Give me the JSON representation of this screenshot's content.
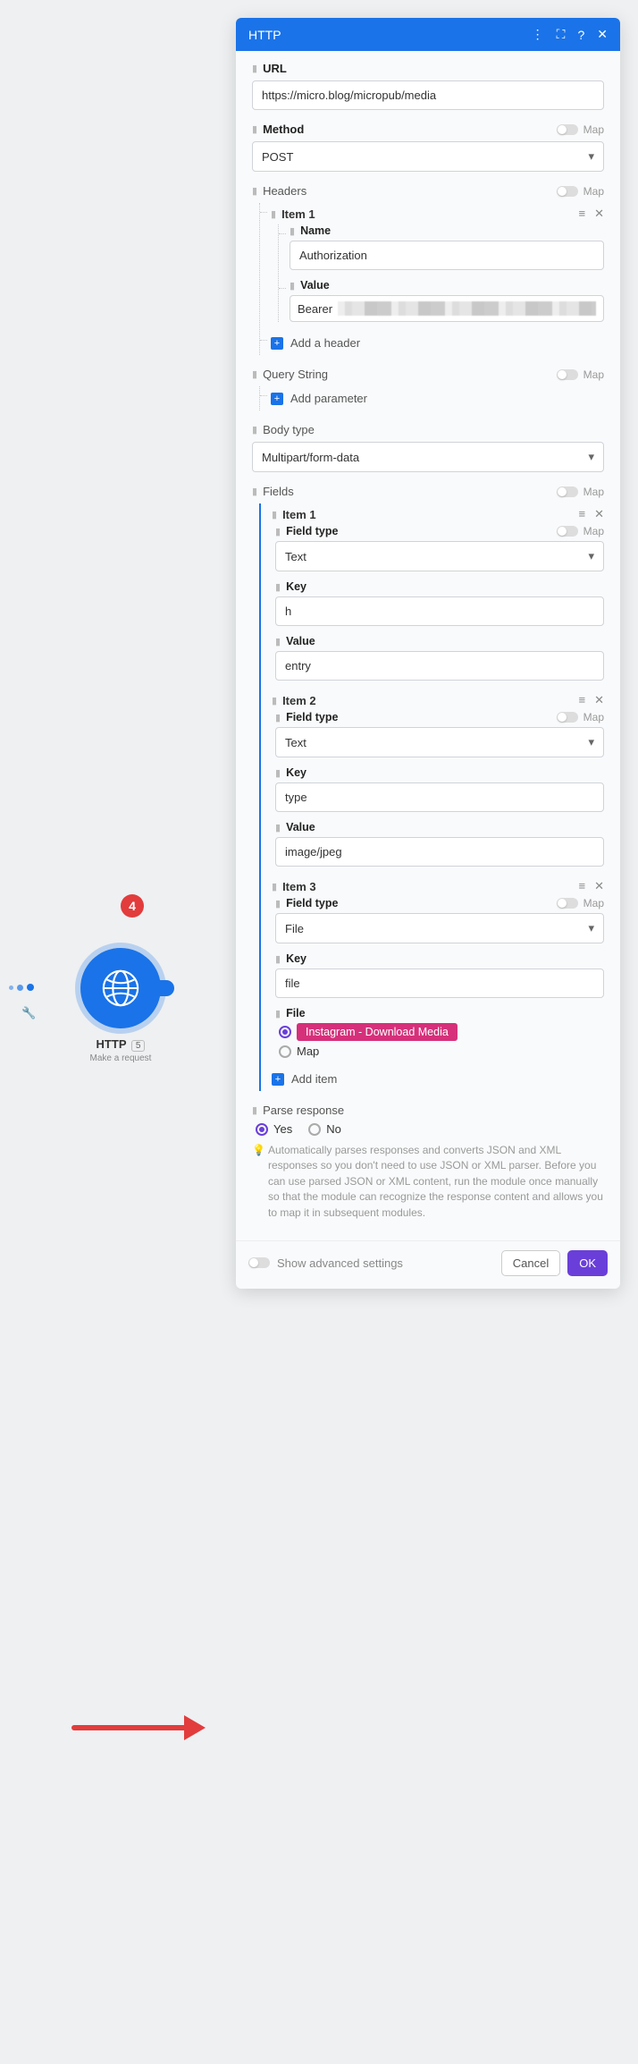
{
  "node": {
    "badge": "4",
    "title": "HTTP",
    "subtitle": "Make a request",
    "module_num": "5"
  },
  "panel": {
    "title": "HTTP",
    "url_label": "URL",
    "url_value": "https://micro.blog/micropub/media",
    "method_label": "Method",
    "method_value": "POST",
    "map_label": "Map",
    "headers_label": "Headers",
    "headers_item1_label": "Item 1",
    "headers_item1_name_label": "Name",
    "headers_item1_name_value": "Authorization",
    "headers_item1_value_label": "Value",
    "headers_item1_value_prefix": "Bearer",
    "add_header_label": "Add a header",
    "query_label": "Query String",
    "add_parameter_label": "Add parameter",
    "body_type_label": "Body type",
    "body_type_value": "Multipart/form-data",
    "fields_label": "Fields",
    "fields": {
      "item1": {
        "title": "Item 1",
        "fieldtype_label": "Field type",
        "fieldtype_value": "Text",
        "key_label": "Key",
        "key_value": "h",
        "value_label": "Value",
        "value_value": "entry"
      },
      "item2": {
        "title": "Item 2",
        "fieldtype_label": "Field type",
        "fieldtype_value": "Text",
        "key_label": "Key",
        "key_value": "type",
        "value_label": "Value",
        "value_value": "image/jpeg"
      },
      "item3": {
        "title": "Item 3",
        "fieldtype_label": "Field type",
        "fieldtype_value": "File",
        "key_label": "Key",
        "key_value": "file",
        "file_label": "File",
        "file_pill": "Instagram - Download Media",
        "file_map_option": "Map"
      }
    },
    "add_item_label": "Add item",
    "parse_response_label": "Parse response",
    "parse_yes": "Yes",
    "parse_no": "No",
    "parse_help": "Automatically parses responses and converts JSON and XML responses so you don't need to use JSON or XML parser. Before you can use parsed JSON or XML content, run the module once manually so that the module can recognize the response content and allows you to map it in subsequent modules.",
    "show_advanced": "Show advanced settings",
    "cancel": "Cancel",
    "ok": "OK"
  }
}
